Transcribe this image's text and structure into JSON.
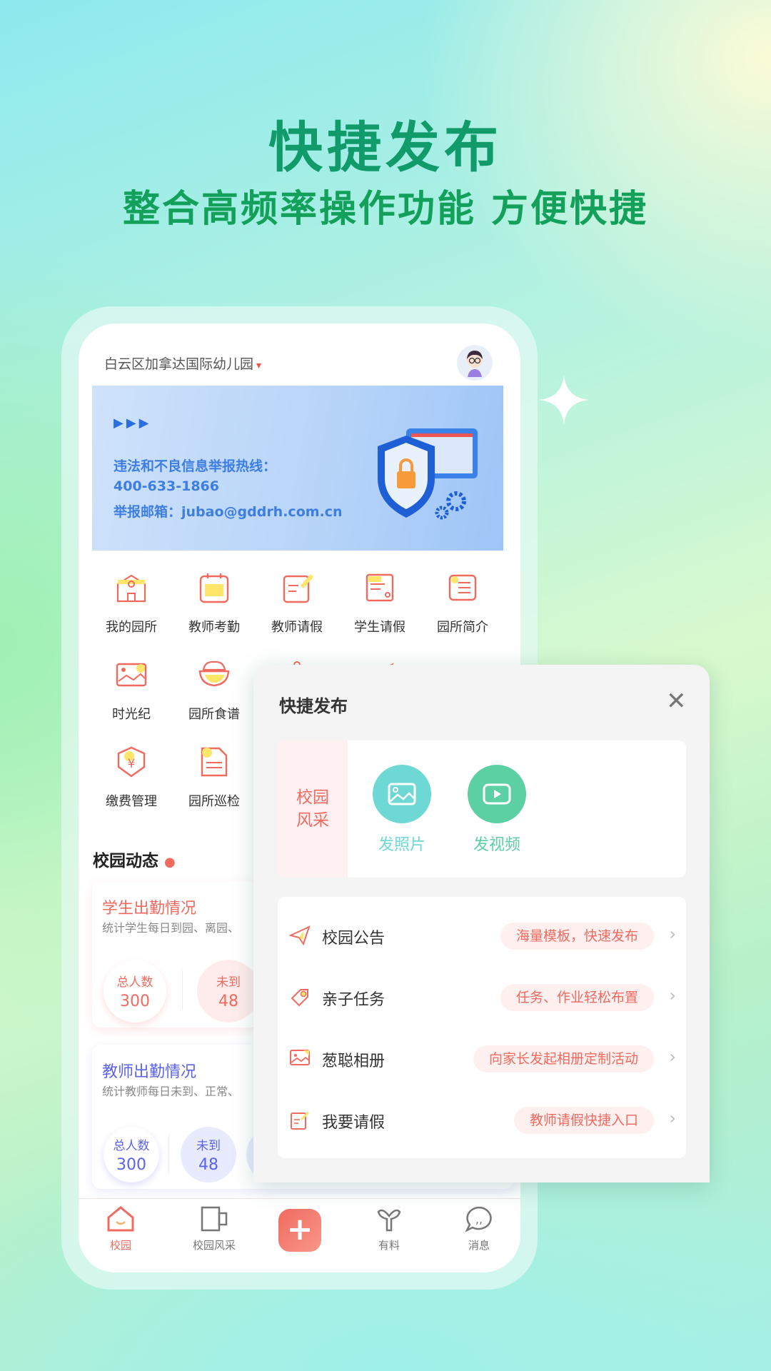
{
  "hero": {
    "title": "快捷发布",
    "subtitle": "整合高频率操作功能  方便快捷"
  },
  "header": {
    "school": "白云区加拿达国际幼儿园",
    "dropdown": "▾"
  },
  "banner": {
    "line1": "违法和不良信息举报热线：",
    "phone": "400-633-1866",
    "email": "举报邮箱：jubao@gddrh.com.cn"
  },
  "grid": [
    {
      "label": "我的园所",
      "icon": "school-building-icon"
    },
    {
      "label": "教师考勤",
      "icon": "calendar-icon"
    },
    {
      "label": "教师请假",
      "icon": "edit-document-icon"
    },
    {
      "label": "学生请假",
      "icon": "student-form-icon"
    },
    {
      "label": "园所简介",
      "icon": "list-icon"
    },
    {
      "label": "时光纪",
      "icon": "image-icon"
    },
    {
      "label": "园所食谱",
      "icon": "rice-bowl-icon"
    },
    {
      "label": "缴费管理",
      "icon": "payment-shield-icon"
    },
    {
      "label": "园所巡检",
      "icon": "inspection-document-icon"
    }
  ],
  "section": {
    "title": "校园动态"
  },
  "student_card": {
    "title": "学生出勤情况",
    "desc": "统计学生每日到园、离园、",
    "total_label": "总人数",
    "total": "300",
    "absent_label": "未到",
    "absent": "48"
  },
  "teacher_card": {
    "title": "教师出勤情况",
    "desc": "统计教师每日未到、正常、",
    "total_label": "总人数",
    "total": "300",
    "absent_label": "未到",
    "absent": "48"
  },
  "nav": [
    {
      "label": "校园",
      "active": true
    },
    {
      "label": "校园风采"
    },
    {
      "label": "+"
    },
    {
      "label": "有料"
    },
    {
      "label": "消息"
    }
  ],
  "modal": {
    "title": "快捷发布",
    "close": "✕",
    "side_label": "校园风采",
    "photo": "发照片",
    "video": "发视频",
    "rows": [
      {
        "label": "校园公告",
        "pill": "海量模板，快速发布"
      },
      {
        "label": "亲子任务",
        "pill": "任务、作业轻松布置"
      },
      {
        "label": "葱聪相册",
        "pill": "向家长发起相册定制活动"
      },
      {
        "label": "我要请假",
        "pill": "教师请假快捷入口"
      }
    ],
    "chevron": "›"
  },
  "colors": {
    "accent": "#f06a5f",
    "teacher": "#5b63e8",
    "photo": "#6dd8d4",
    "video": "#5ccfa3",
    "hero": "#119a6a"
  }
}
